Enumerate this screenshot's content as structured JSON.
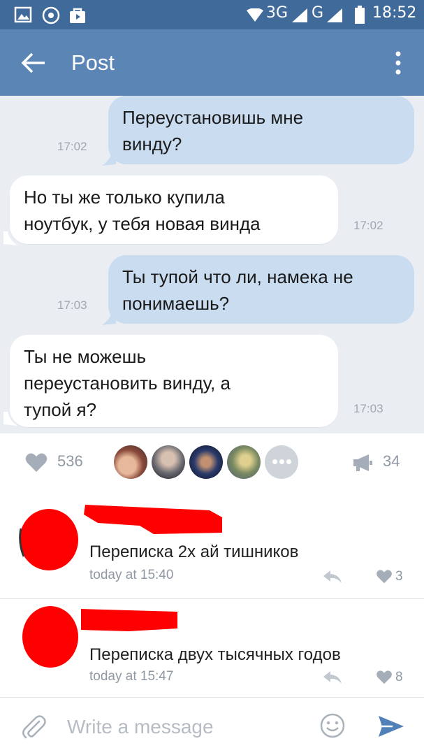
{
  "status_bar": {
    "network_3g": "3G",
    "network_g": "G",
    "time": "18:52"
  },
  "app_bar": {
    "title": "Post"
  },
  "messages": [
    {
      "direction": "out",
      "lines": [
        "Переустановишь мне",
        "винду?"
      ],
      "time": "17:02"
    },
    {
      "direction": "in",
      "lines": [
        "Но ты же только купила",
        "ноутбук, у тебя новая винда"
      ],
      "time": "17:02"
    },
    {
      "direction": "out",
      "lines": [
        "Ты тупой что ли, намека не",
        "понимаешь?"
      ],
      "time": "17:03"
    },
    {
      "direction": "in",
      "lines": [
        "Ты не можешь",
        "переустановить винду, а",
        "тупой я?"
      ],
      "time": "17:03"
    }
  ],
  "reactions": {
    "likes": "536",
    "reposts": "34"
  },
  "comments": [
    {
      "text": "Переписка 2х ай тишников",
      "date": "today at 15:40",
      "likes": "3"
    },
    {
      "text": "Переписка двух тысячных годов",
      "date": "today at 15:47",
      "likes": "8"
    }
  ],
  "composer": {
    "placeholder": "Write a message"
  },
  "colors": {
    "status_bar": "#3f6a9a",
    "app_bar": "#5a85b5",
    "chat_background": "#eaeef3",
    "outgoing_bubble": "#c9dcf0",
    "incoming_bubble": "#ffffff",
    "accent": "#5181b8",
    "redaction": "#ff0000"
  },
  "icons": {
    "back": "arrow-left-icon",
    "menu": "more-vertical-icon",
    "like": "heart-icon",
    "share": "megaphone-icon",
    "reply": "reply-icon",
    "attach": "paperclip-icon",
    "emoji": "smile-icon",
    "send": "send-icon"
  }
}
